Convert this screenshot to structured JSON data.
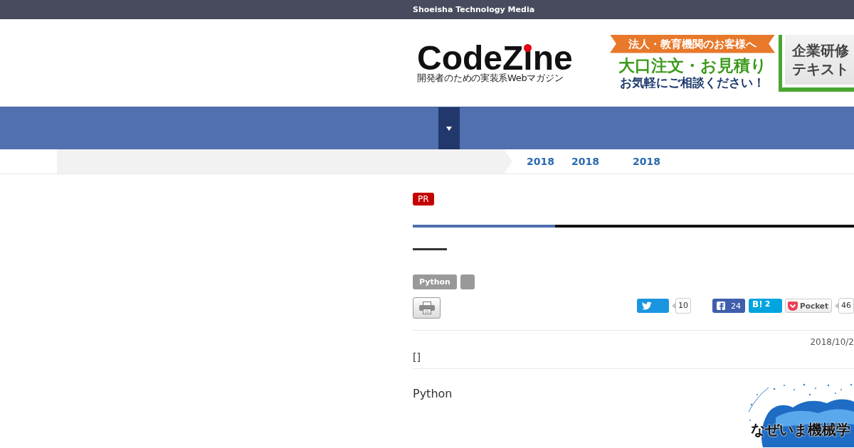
{
  "top_bar": {
    "title": "Shoeisha Technology Media"
  },
  "header": {
    "logo": {
      "name": "CodeZine",
      "tagline": "開発者のための実装系Webマガジン"
    },
    "banner": {
      "ribbon": "法人・教育機関のお客様へ",
      "headline": "大口注文・お見積り",
      "subline": "お気軽にご相談ください！",
      "book_lines": [
        "企業研修",
        "テキスト"
      ]
    }
  },
  "breadcrumbs": [
    {
      "label": "2018"
    },
    {
      "label": "2018"
    },
    {
      "label": "2018"
    }
  ],
  "article": {
    "badge": "PR",
    "tags": [
      {
        "kind": "text",
        "label": "Python"
      },
      {
        "kind": "empty"
      }
    ],
    "share": [
      {
        "kind": "twitter",
        "count": "10"
      },
      {
        "kind": "facebook",
        "count": "24"
      },
      {
        "kind": "hatena",
        "label": "B!",
        "count": "2"
      },
      {
        "kind": "pocket",
        "label": "Pocket",
        "count": "46"
      }
    ],
    "date": "2018/10/2",
    "meta": "[]",
    "body": "Python",
    "promo": {
      "title": "なぜいま機械学"
    }
  }
}
